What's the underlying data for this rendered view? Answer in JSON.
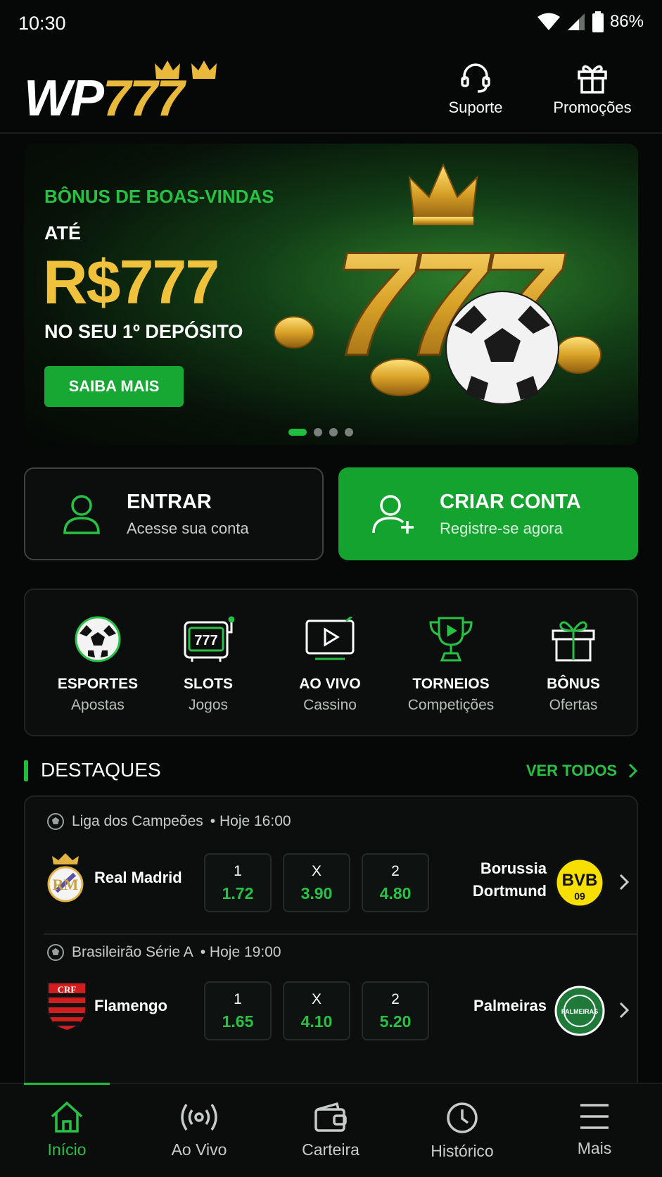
{
  "status_bar": {
    "time": "10:30",
    "battery": "86%"
  },
  "header": {
    "logo_wp": "WP",
    "logo_num": "777",
    "support_label": "Suporte",
    "promotions_label": "Promoções"
  },
  "banner": {
    "kicker": "BÔNUS DE BOAS-VINDAS",
    "up_to": "ATÉ",
    "amount": "R$777",
    "subtitle": "NO SEU 1º DEPÓSITO",
    "cta": "SAIBA MAIS",
    "art_number": "777",
    "slides_total": 4,
    "active_slide": 1
  },
  "auth": {
    "login_title": "ENTRAR",
    "login_sub": "Acesse sua conta",
    "signup_title": "CRIAR CONTA",
    "signup_sub": "Registre-se agora"
  },
  "categories": [
    {
      "title": "ESPORTES",
      "sub": "Apostas",
      "icon": "soccer-ball-icon"
    },
    {
      "title": "SLOTS",
      "sub": "Jogos",
      "icon": "slot-machine-icon"
    },
    {
      "title": "AO VIVO",
      "sub": "Cassino",
      "icon": "live-video-icon"
    },
    {
      "title": "TORNEIOS",
      "sub": "Competições",
      "icon": "trophy-icon"
    },
    {
      "title": "BÔNUS",
      "sub": "Ofertas",
      "icon": "gift-icon"
    }
  ],
  "highlights": {
    "title": "DESTAQUES",
    "see_all": "VER TODOS",
    "matches": [
      {
        "league": "Liga dos Campeões",
        "time": "• Hoje 16:00",
        "home": "Real Madrid",
        "away_line1": "Borussia",
        "away_line2": "Dortmund",
        "away_badge": "BVB",
        "away_badge_sub": "09",
        "odds": [
          {
            "label": "1",
            "value": "1.72"
          },
          {
            "label": "X",
            "value": "3.90"
          },
          {
            "label": "2",
            "value": "4.80"
          }
        ]
      },
      {
        "league": "Brasileirão Série A",
        "time": "• Hoje 19:00",
        "home": "Flamengo",
        "home_badge": "CRF",
        "away_line1": "Palmeiras",
        "away_line2": "",
        "away_badge": "PALMEIRAS",
        "odds": [
          {
            "label": "1",
            "value": "1.65"
          },
          {
            "label": "X",
            "value": "4.10"
          },
          {
            "label": "2",
            "value": "5.20"
          }
        ]
      }
    ]
  },
  "nav": {
    "home": "Início",
    "live": "Ao Vivo",
    "wallet": "Carteira",
    "history": "Histórico",
    "more": "Mais"
  },
  "colors": {
    "background": "#060807",
    "accent_green": "#1fbe3d",
    "gold": "#f0c23c"
  }
}
